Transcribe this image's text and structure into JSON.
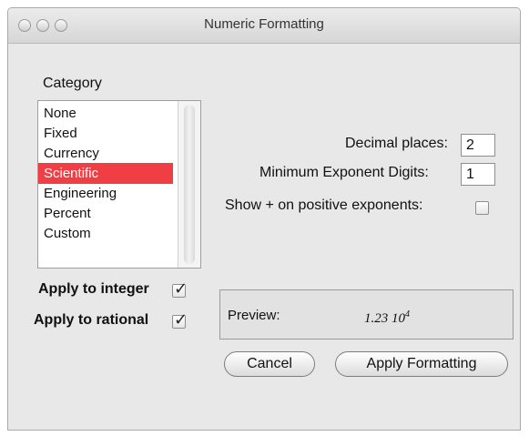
{
  "window": {
    "title": "Numeric Formatting"
  },
  "category": {
    "label": "Category",
    "items": [
      "None",
      "Fixed",
      "Currency",
      "Scientific",
      "Engineering",
      "Percent",
      "Custom"
    ],
    "selected": "Scientific"
  },
  "options": {
    "decimal_places_label": "Decimal places:",
    "decimal_places_value": "2",
    "min_exp_digits_label": "Minimum Exponent Digits:",
    "min_exp_digits_value": "1",
    "show_plus_label": "Show + on positive exponents:",
    "show_plus_checked": false
  },
  "apply": {
    "integer_label": "Apply to integer",
    "integer_checked": true,
    "rational_label": "Apply to rational",
    "rational_checked": true
  },
  "preview": {
    "label": "Preview:",
    "mantissa": "1.23 10",
    "exponent": "4"
  },
  "buttons": {
    "cancel": "Cancel",
    "apply": "Apply Formatting"
  },
  "colors": {
    "selection": "#ef3f45",
    "window_bg": "#e8e8e8"
  }
}
